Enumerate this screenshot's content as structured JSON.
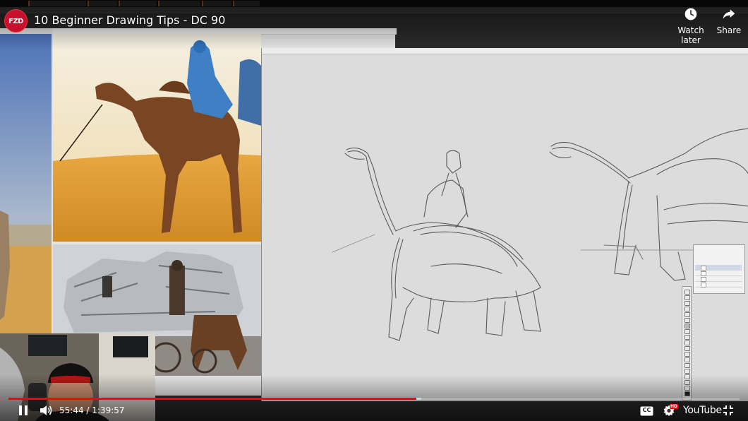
{
  "video": {
    "title": "10 Beginner Drawing Tips - DC 90",
    "channel_logo_text": "FZD",
    "watch_later_label": "Watch later",
    "share_label": "Share",
    "current_time": "55:44",
    "time_separator": " / ",
    "duration": "1:39:57",
    "progress_fraction": 0.558,
    "buffered_fraction": 0.565,
    "cc_label": "CC",
    "hd_badge": "HD",
    "brand_label": "YouTube"
  },
  "colors": {
    "progress": "#ff0000",
    "channel_logo": "#c8102e"
  },
  "icons": {
    "watch_later": "clock-icon",
    "share": "share-arrow-icon",
    "play_pause": "pause-icon",
    "volume": "volume-icon",
    "captions": "cc-icon",
    "settings": "gear-icon",
    "fullscreen": "exit-fullscreen-icon"
  }
}
